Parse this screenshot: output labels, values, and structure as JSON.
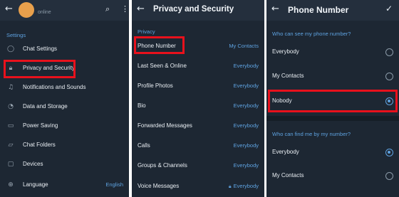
{
  "settings": {
    "status": "online",
    "section_title": "Settings",
    "items": [
      {
        "label": "Chat Settings",
        "icon": "chat-bubble-icon"
      },
      {
        "label": "Privacy and Security",
        "icon": "lock-icon"
      },
      {
        "label": "Notifications and Sounds",
        "icon": "bell-icon"
      },
      {
        "label": "Data and Storage",
        "icon": "clock-icon"
      },
      {
        "label": "Power Saving",
        "icon": "battery-icon"
      },
      {
        "label": "Chat Folders",
        "icon": "folder-icon"
      },
      {
        "label": "Devices",
        "icon": "laptop-icon"
      },
      {
        "label": "Language",
        "icon": "globe-icon",
        "value": "English"
      }
    ]
  },
  "privacy": {
    "title": "Privacy and Security",
    "section_title": "Privacy",
    "items": [
      {
        "label": "Phone Number",
        "value": "My Contacts"
      },
      {
        "label": "Last Seen & Online",
        "value": "Everybody"
      },
      {
        "label": "Profile Photos",
        "value": "Everybody"
      },
      {
        "label": "Bio",
        "value": "Everybody"
      },
      {
        "label": "Forwarded Messages",
        "value": "Everybody"
      },
      {
        "label": "Calls",
        "value": "Everybody"
      },
      {
        "label": "Groups & Channels",
        "value": "Everybody"
      },
      {
        "label": "Voice Messages",
        "value": "Everybody",
        "locked": true
      }
    ]
  },
  "phone_number": {
    "title": "Phone Number",
    "see_section": "Who can see my phone number?",
    "see_options": [
      {
        "label": "Everybody",
        "selected": false
      },
      {
        "label": "My Contacts",
        "selected": false
      },
      {
        "label": "Nobody",
        "selected": true
      }
    ],
    "find_section": "Who can find me by my number?",
    "find_options": [
      {
        "label": "Everybody",
        "selected": true
      },
      {
        "label": "My Contacts",
        "selected": false
      }
    ]
  },
  "colors": {
    "background": "#1d2733",
    "header": "#242f3d",
    "accent": "#5ea2e0",
    "highlight": "#e8111c",
    "avatar": "#e8a04c"
  }
}
